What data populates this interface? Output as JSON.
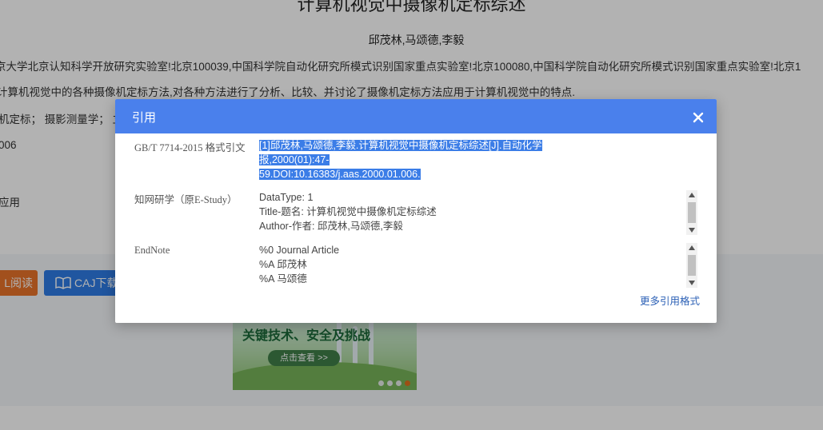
{
  "article": {
    "title": "计算机视觉中摄像机定标综述",
    "authors": "邱茂林,马颂德,李毅",
    "affiliation": "京大学北京认知科学开放研究实验室!北京100039,中国科学院自动化研究所模式识别国家重点实验室!北京100080,中国科学院自动化研究所模式识别国家重点实验室!北京1",
    "abstract": "计算机视觉中的各种摄像机定标方法,对各种方法进行了分析、比较、并讨论了摄像机定标方法应用于计算机视觉中的特点.",
    "keywords": "机定标；  摄影测量学；  立",
    "doi_fragment": "006",
    "classify_fragment": "应用"
  },
  "actions": {
    "html_read_label": "L阅读",
    "caj_download_label": "CAJ下载"
  },
  "banner": {
    "title": "关键技术、安全及挑战",
    "button_label": "点击查看 >>",
    "slide_count": 4,
    "active_slide": 4
  },
  "colors": {
    "modal_header": "#4a80ec",
    "selection": "#3b7de7",
    "html_read_button": "#e8732a",
    "caj_button": "#2e7ce6",
    "link": "#2a5fb5"
  },
  "modal": {
    "title": "引用",
    "close_icon": "close-icon",
    "gbt": {
      "label": "GB/T 7714-2015 格式引文",
      "line1": "[1]邱茂林,马颂德,李毅.计算机视觉中摄像机定标综述[J].自动化学报,2000(01):47-",
      "line2": "59.DOI:10.16383/j.aas.2000.01.006."
    },
    "estudy": {
      "label": "知网研学（原E-Study）",
      "lines": [
        "DataType: 1",
        "Title-题名: 计算机视觉中摄像机定标综述",
        "Author-作者: 邱茂林,马颂德,李毅"
      ]
    },
    "endnote": {
      "label": "EndNote",
      "lines": [
        "%0 Journal Article",
        "%A 邱茂林",
        "%A 马颂德"
      ]
    },
    "more_link": "更多引用格式"
  }
}
